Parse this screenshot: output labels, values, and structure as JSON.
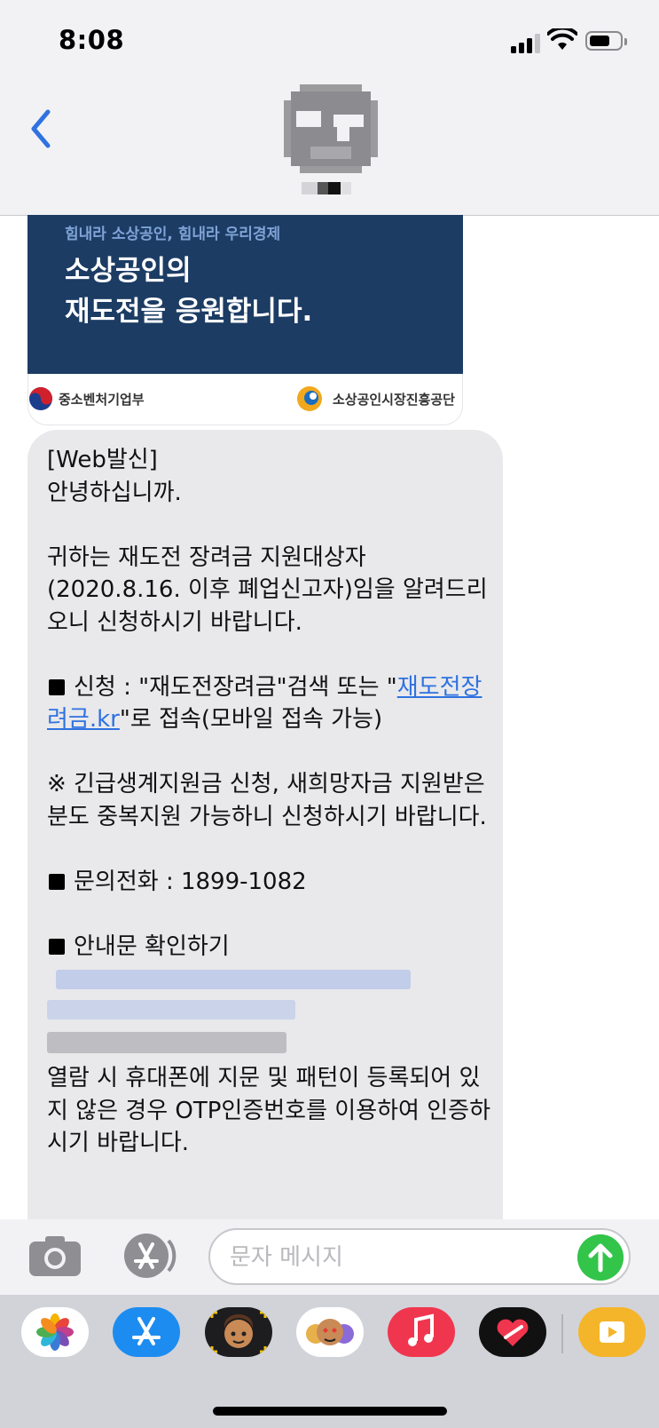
{
  "status_bar": {
    "time": "8:08"
  },
  "conversation": {
    "contact_avatar": "pixelated-avatar",
    "contact_name_hidden": true
  },
  "banner": {
    "subtitle": "힘내라 소상공인, 힘내라 우리경제",
    "title": "소상공인의\n재도전을 응원합니다.",
    "logo_left": "중소벤처기업부",
    "logo_right": "소상공인시장진흥공단"
  },
  "message": {
    "line1": "[Web발신]",
    "line2": "안녕하십니까.",
    "para1": "귀하는 재도전 장려금 지원대상자 (2020.8.16. 이후 폐업신고자)임을 알려드리오니 신청하시기 바랍니다.",
    "apply_prefix": "신청 : \"재도전장려금\"검색 또는 \"",
    "apply_link": "재도전장려금.kr",
    "apply_suffix": "\"로 접속(모바일 접속 가능)",
    "note": "※ 긴급생계지원금 신청, 새희망자금 지원받은분도 중복지원 가능하니 신청하시기 바랍니다.",
    "phone": "문의전화 : 1899-1082",
    "guide": "안내문 확인하기",
    "closing": "열람 시 휴대폰에 지문 및 패턴이 등록되어 있지 않은 경우 OTP인증번호를 이용하여 인증하시기 바랍니다."
  },
  "input_bar": {
    "placeholder": "문자 메시지",
    "camera_icon": "camera-icon",
    "apps_icon": "app-store-icon",
    "send_icon": "send-arrow-icon"
  },
  "app_tray": [
    "photos-icon",
    "app-store-icon",
    "memoji-icon",
    "memoji-stickers-icon",
    "music-icon",
    "digital-touch-icon",
    "video-app-icon"
  ],
  "colors": {
    "accent": "#2f72e0",
    "bubble": "#e9e9eb",
    "send": "#33c44a",
    "banner": "#1c3c64"
  }
}
